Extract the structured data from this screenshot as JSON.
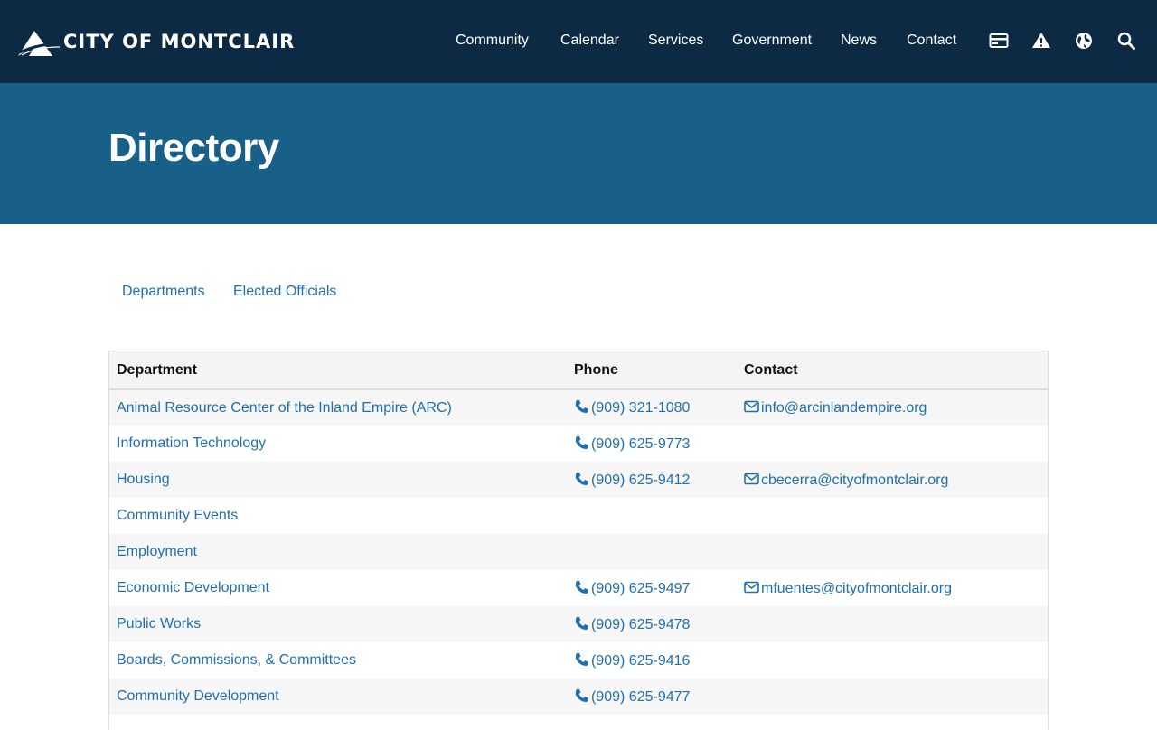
{
  "header": {
    "logo_text": "CITY OF MONTCLAIR",
    "nav": [
      "Community",
      "Calendar",
      "Services",
      "Government",
      "News",
      "Contact"
    ],
    "icons": [
      "payment-card-icon",
      "alert-icon",
      "globe-icon",
      "search-icon"
    ]
  },
  "hero": {
    "title": "Directory"
  },
  "tabs": [
    "Departments",
    "Elected Officials"
  ],
  "table": {
    "headers": [
      "Department",
      "Phone",
      "Contact"
    ],
    "rows": [
      {
        "department": "Animal Resource Center of the Inland Empire (ARC)",
        "phone": "(909) 321-1080",
        "email": "info@arcinlandempire.org"
      },
      {
        "department": "Information Technology",
        "phone": "(909) 625-9773",
        "email": ""
      },
      {
        "department": "Housing",
        "phone": "(909) 625-9412",
        "email": "cbecerra@cityofmontclair.org"
      },
      {
        "department": "Community Events",
        "phone": "",
        "email": ""
      },
      {
        "department": "Employment",
        "phone": "",
        "email": ""
      },
      {
        "department": "Economic Development",
        "phone": "(909) 625-9497",
        "email": "mfuentes@cityofmontclair.org"
      },
      {
        "department": "Public Works",
        "phone": "(909) 625-9478",
        "email": ""
      },
      {
        "department": "Boards, Commissions, & Committees",
        "phone": "(909) 625-9416",
        "email": ""
      },
      {
        "department": "Community Development",
        "phone": "(909) 625-9477",
        "email": ""
      }
    ]
  },
  "colors": {
    "header_bg": "#0c2a44",
    "hero_bg": "#186088",
    "link": "#1f6fae"
  }
}
